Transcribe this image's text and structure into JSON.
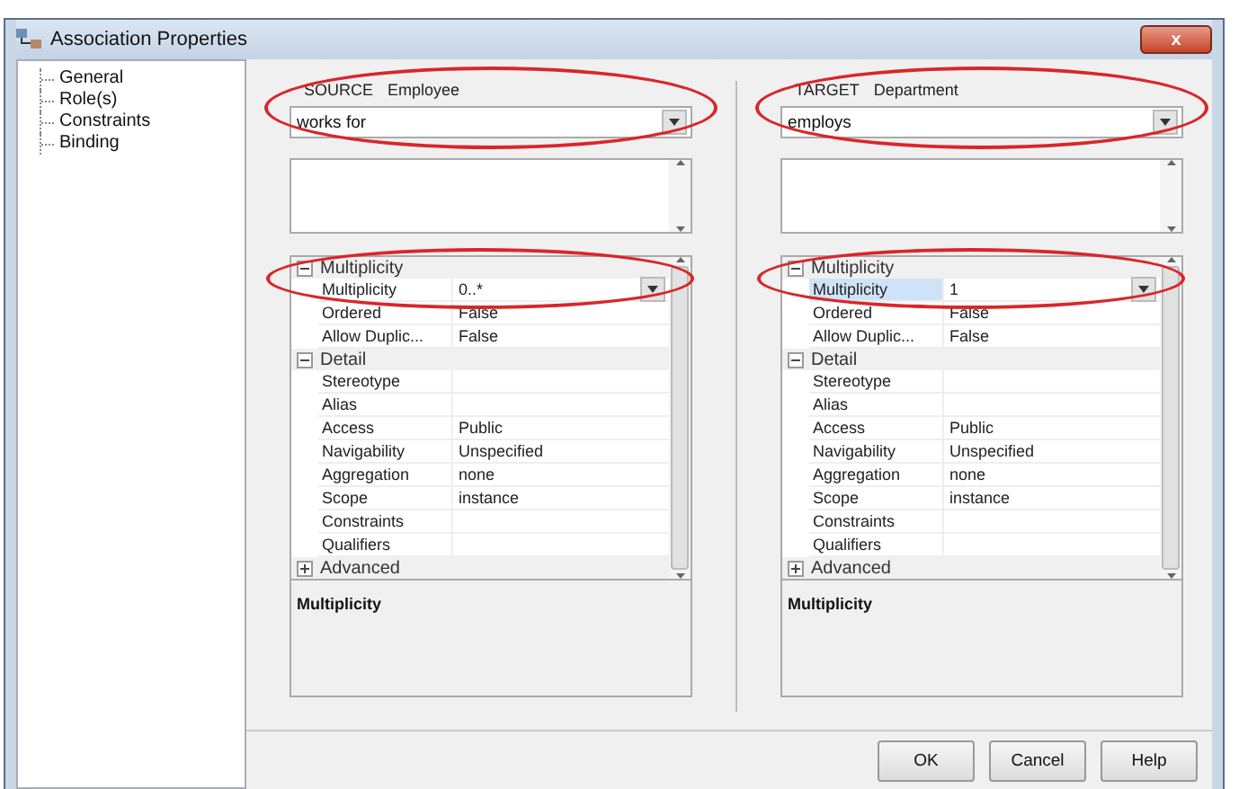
{
  "window": {
    "title": "Association Properties",
    "close": "x"
  },
  "nav": {
    "items": [
      {
        "label": "General"
      },
      {
        "label": "Role(s)"
      },
      {
        "label": "Constraints"
      },
      {
        "label": "Binding"
      }
    ]
  },
  "roles": [
    {
      "heading": "SOURCE",
      "entity": "Employee",
      "role_name": "works for",
      "circled": true,
      "description": "Multiplicity",
      "categories": [
        {
          "name": "Multiplicity",
          "expanded": true,
          "circled": true,
          "rows": [
            {
              "name": "Multiplicity",
              "value": "0..*",
              "selected": false,
              "dropdown": true
            },
            {
              "name": "Ordered",
              "value": "False",
              "selected": false,
              "dropdown": false
            },
            {
              "name": "Allow Duplic...",
              "value": "False",
              "selected": false,
              "dropdown": false
            }
          ]
        },
        {
          "name": "Detail",
          "expanded": true,
          "circled": false,
          "rows": [
            {
              "name": "Stereotype",
              "value": "",
              "selected": false,
              "dropdown": false
            },
            {
              "name": "Alias",
              "value": "",
              "selected": false,
              "dropdown": false
            },
            {
              "name": "Access",
              "value": "Public",
              "selected": false,
              "dropdown": false
            },
            {
              "name": "Navigability",
              "value": "Unspecified",
              "selected": false,
              "dropdown": false
            },
            {
              "name": "Aggregation",
              "value": "none",
              "selected": false,
              "dropdown": false
            },
            {
              "name": "Scope",
              "value": "instance",
              "selected": false,
              "dropdown": false
            },
            {
              "name": "Constraints",
              "value": "",
              "selected": false,
              "dropdown": false
            },
            {
              "name": "Qualifiers",
              "value": "",
              "selected": false,
              "dropdown": false
            }
          ]
        },
        {
          "name": "Advanced",
          "expanded": false,
          "circled": false
        }
      ]
    },
    {
      "heading": "TARGET",
      "entity": "Department",
      "role_name": "employs",
      "circled": true,
      "description": "Multiplicity",
      "categories": [
        {
          "name": "Multiplicity",
          "expanded": true,
          "circled": true,
          "rows": [
            {
              "name": "Multiplicity",
              "value": "1",
              "selected": true,
              "dropdown": true
            },
            {
              "name": "Ordered",
              "value": "False",
              "selected": false,
              "dropdown": false
            },
            {
              "name": "Allow Duplic...",
              "value": "False",
              "selected": false,
              "dropdown": false
            }
          ]
        },
        {
          "name": "Detail",
          "expanded": true,
          "circled": false,
          "rows": [
            {
              "name": "Stereotype",
              "value": "",
              "selected": false,
              "dropdown": false
            },
            {
              "name": "Alias",
              "value": "",
              "selected": false,
              "dropdown": false
            },
            {
              "name": "Access",
              "value": "Public",
              "selected": false,
              "dropdown": false
            },
            {
              "name": "Navigability",
              "value": "Unspecified",
              "selected": false,
              "dropdown": false
            },
            {
              "name": "Aggregation",
              "value": "none",
              "selected": false,
              "dropdown": false
            },
            {
              "name": "Scope",
              "value": "instance",
              "selected": false,
              "dropdown": false
            },
            {
              "name": "Constraints",
              "value": "",
              "selected": false,
              "dropdown": false
            },
            {
              "name": "Qualifiers",
              "value": "",
              "selected": false,
              "dropdown": false
            }
          ]
        },
        {
          "name": "Advanced",
          "expanded": false,
          "circled": false
        }
      ]
    }
  ],
  "buttons": [
    "OK",
    "Cancel",
    "Help"
  ]
}
